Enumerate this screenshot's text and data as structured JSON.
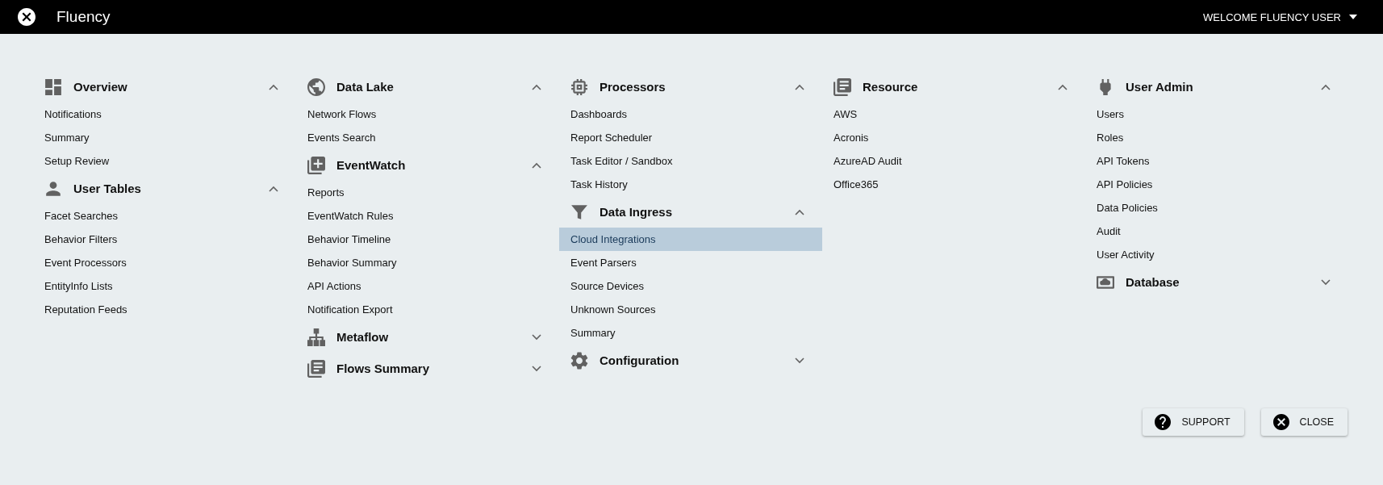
{
  "app_bar": {
    "title": "Fluency",
    "user_menu": "WELCOME FLUENCY USER"
  },
  "columns": [
    {
      "sections": [
        {
          "title": "Overview",
          "expanded": true,
          "items": [
            {
              "label": "Notifications",
              "selected": false
            },
            {
              "label": "Summary",
              "selected": false
            },
            {
              "label": "Setup Review",
              "selected": false
            }
          ]
        },
        {
          "title": "User Tables",
          "expanded": true,
          "items": [
            {
              "label": "Facet Searches",
              "selected": false
            },
            {
              "label": "Behavior Filters",
              "selected": false
            },
            {
              "label": "Event Processors",
              "selected": false
            },
            {
              "label": "EntityInfo Lists",
              "selected": false
            },
            {
              "label": "Reputation Feeds",
              "selected": false
            }
          ]
        }
      ]
    },
    {
      "sections": [
        {
          "title": "Data Lake",
          "expanded": true,
          "items": [
            {
              "label": "Network Flows",
              "selected": false
            },
            {
              "label": "Events Search",
              "selected": false
            }
          ]
        },
        {
          "title": "EventWatch",
          "expanded": true,
          "items": [
            {
              "label": "Reports",
              "selected": false
            },
            {
              "label": "EventWatch Rules",
              "selected": false
            },
            {
              "label": "Behavior Timeline",
              "selected": false
            },
            {
              "label": "Behavior Summary",
              "selected": false
            },
            {
              "label": "API Actions",
              "selected": false
            },
            {
              "label": "Notification Export",
              "selected": false
            }
          ]
        },
        {
          "title": "Metaflow",
          "expanded": false
        },
        {
          "title": "Flows Summary",
          "expanded": false
        }
      ]
    },
    {
      "sections": [
        {
          "title": "Processors",
          "expanded": true,
          "items": [
            {
              "label": "Dashboards",
              "selected": false
            },
            {
              "label": "Report Scheduler",
              "selected": false
            },
            {
              "label": "Task Editor / Sandbox",
              "selected": false
            },
            {
              "label": "Task History",
              "selected": false
            }
          ]
        },
        {
          "title": "Data Ingress",
          "expanded": true,
          "items": [
            {
              "label": "Cloud Integrations",
              "selected": true
            },
            {
              "label": "Event Parsers",
              "selected": false
            },
            {
              "label": "Source Devices",
              "selected": false
            },
            {
              "label": "Unknown Sources",
              "selected": false
            },
            {
              "label": "Summary",
              "selected": false
            }
          ]
        },
        {
          "title": "Configuration",
          "expanded": false
        }
      ]
    },
    {
      "sections": [
        {
          "title": "Resource",
          "expanded": true,
          "items": [
            {
              "label": "AWS",
              "selected": false
            },
            {
              "label": "Acronis",
              "selected": false
            },
            {
              "label": "AzureAD Audit",
              "selected": false
            },
            {
              "label": "Office365",
              "selected": false
            }
          ]
        }
      ]
    },
    {
      "sections": [
        {
          "title": "User Admin",
          "expanded": true,
          "items": [
            {
              "label": "Users",
              "selected": false
            },
            {
              "label": "Roles",
              "selected": false
            },
            {
              "label": "API Tokens",
              "selected": false
            },
            {
              "label": "API Policies",
              "selected": false
            },
            {
              "label": "Data Policies",
              "selected": false
            },
            {
              "label": "Audit",
              "selected": false
            },
            {
              "label": "User Activity",
              "selected": false
            }
          ]
        },
        {
          "title": "Database",
          "expanded": false
        }
      ]
    }
  ],
  "buttons": [
    {
      "label": "SUPPORT",
      "kind": "help"
    },
    {
      "label": "CLOSE",
      "kind": "close"
    }
  ]
}
